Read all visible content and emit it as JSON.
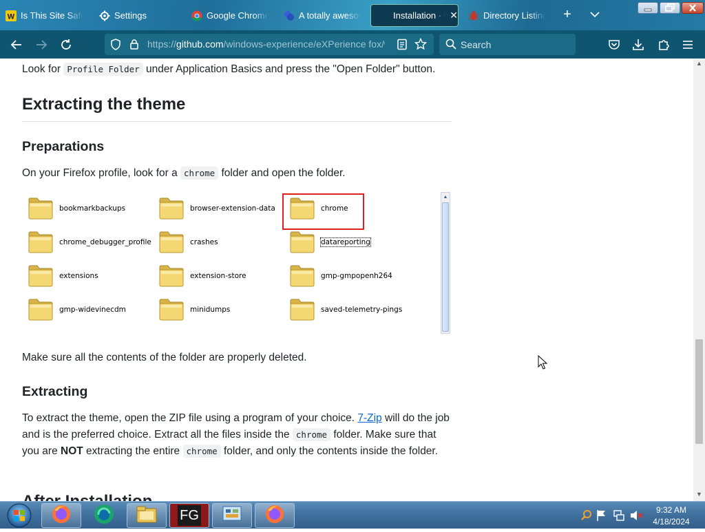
{
  "tabs": [
    {
      "label": "Is This Site Safe?",
      "icon": "w-logo-icon",
      "active": false
    },
    {
      "label": "Settings",
      "icon": "gear-icon",
      "active": false
    },
    {
      "label": "Google Chrome",
      "icon": "chrome-icon",
      "active": false
    },
    {
      "label": "A totally awesome",
      "icon": "globe-icon",
      "active": false
    },
    {
      "label": "Installation · w",
      "icon": "github-icon",
      "active": true
    },
    {
      "label": "Directory Listing",
      "icon": "bug-icon",
      "active": false
    }
  ],
  "navbar": {
    "url_prefix": "https://",
    "url_host": "github.com",
    "url_path": "/windows-experience/eXPerience fox/w",
    "search_placeholder": "Search"
  },
  "content": {
    "intro_before": "Look for",
    "intro_code": "Profile Folder",
    "intro_after": "under Application Basics and press the \"Open Folder\" button.",
    "h2": "Extracting the theme",
    "h3_prep": "Preparations",
    "prep_before": "On your Firefox profile, look for a",
    "prep_code": "chrome",
    "prep_after": "folder and open the folder.",
    "deleted_note": "Make sure all the contents of the folder are properly deleted.",
    "h3_extract": "Extracting",
    "ext_1": "To extract the theme, open the ZIP file using a program of your choice.",
    "ext_link": "7-Zip",
    "ext_2": "will do the job and is the preferred choice. Extract all the files inside the",
    "ext_code1": "chrome",
    "ext_3": "folder. Make sure that you are",
    "ext_bold": "NOT",
    "ext_4": "extracting the entire",
    "ext_code2": "chrome",
    "ext_5": "folder, and only the contents inside the folder.",
    "h2_after": "After Installation"
  },
  "folders": [
    "bookmarkbackups",
    "browser-extension-data",
    "chrome",
    "chrome_debugger_profile",
    "crashes",
    "datareporting",
    "extensions",
    "extension-store",
    "gmp-gmpopenh264",
    "gmp-widevinecdm",
    "minidumps",
    "saved-telemetry-pings"
  ],
  "taskbar": {
    "apps": [
      "firefox-icon",
      "edge-icon",
      "file-explorer-icon",
      "fg-app-icon",
      "control-panel-icon",
      "firefox-icon"
    ],
    "fg_label": "FG",
    "time": "9:32 AM",
    "date": "4/18/2024"
  },
  "colors": {
    "tabbar": "#247aa6",
    "navbar": "#0f5570",
    "link": "#0969da",
    "highlight": "#e02020"
  }
}
